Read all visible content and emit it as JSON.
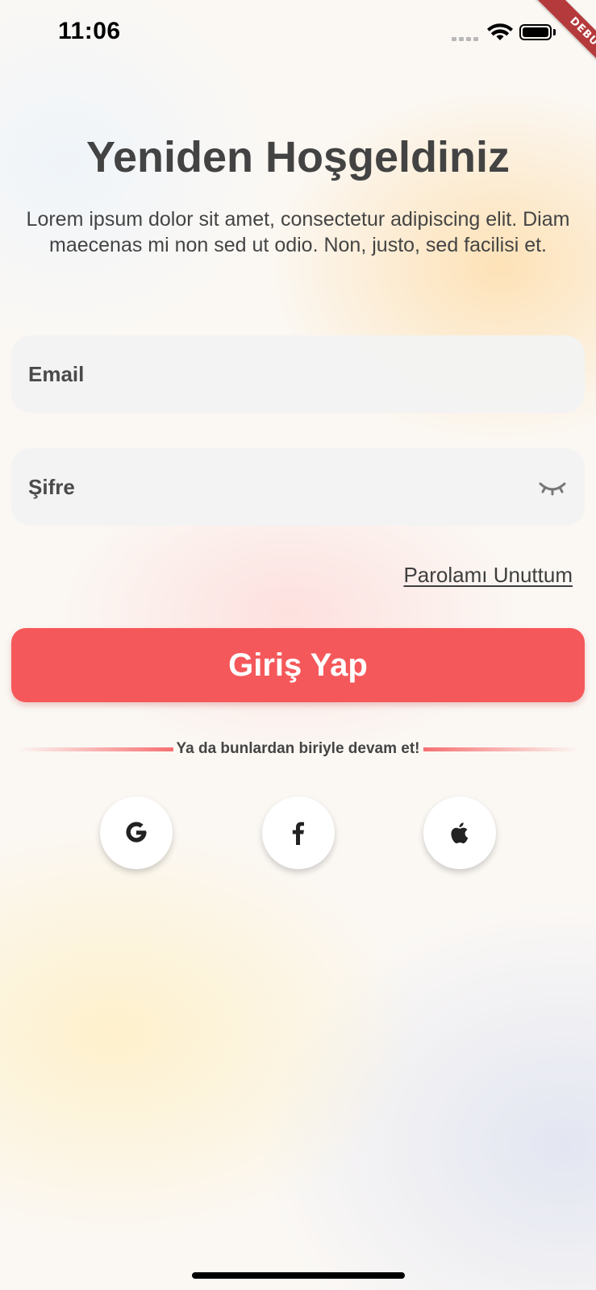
{
  "status_bar": {
    "time": "11:06"
  },
  "debug_banner": {
    "label": "DEBUG",
    "color": "#b53a3c"
  },
  "header": {
    "title": "Yeniden Hoşgeldiniz",
    "subtitle": "Lorem ipsum dolor sit amet, consectetur adipiscing elit. Diam maecenas mi non sed ut odio. Non, justo, sed facilisi et."
  },
  "form": {
    "email": {
      "placeholder": "Email",
      "value": ""
    },
    "password": {
      "placeholder": "Şifre",
      "value": "",
      "toggle_icon": "eye-closed-icon"
    },
    "forgot_password_label": "Parolamı Unuttum",
    "login_label": "Giriş Yap"
  },
  "divider": {
    "label": "Ya da bunlardan biriyle devam et!"
  },
  "social": {
    "buttons": [
      {
        "icon": "google-icon"
      },
      {
        "icon": "facebook-icon"
      },
      {
        "icon": "apple-icon"
      }
    ]
  },
  "colors": {
    "accent": "#f5585a",
    "text": "#434343",
    "input_bg": "#f3f3f3"
  }
}
